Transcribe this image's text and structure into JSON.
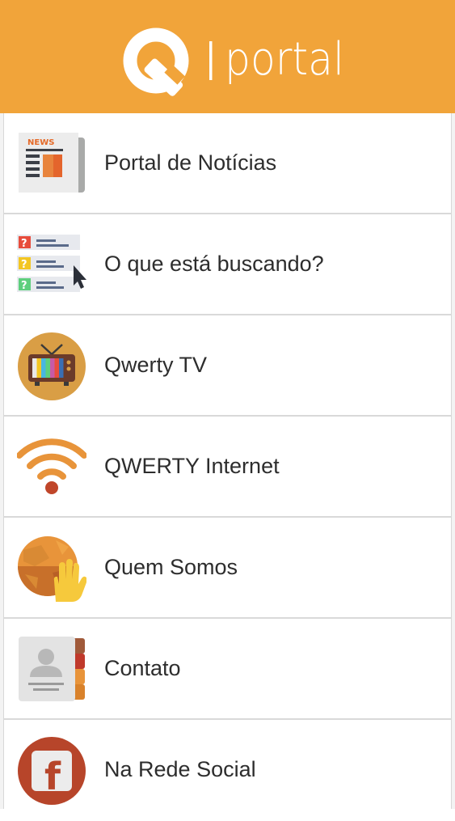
{
  "header": {
    "brand_text": "portal",
    "background_color": "#f1a43a"
  },
  "menu": {
    "items": [
      {
        "label": "Portal de Notícias",
        "icon": "newspaper-icon",
        "badge": "NEWS"
      },
      {
        "label": "O que está buscando?",
        "icon": "question-list-icon",
        "marks": [
          "?",
          "?",
          "?"
        ]
      },
      {
        "label": "Qwerty TV",
        "icon": "tv-icon"
      },
      {
        "label": "QWERTY Internet",
        "icon": "wifi-icon"
      },
      {
        "label": "Quem Somos",
        "icon": "globe-hand-icon"
      },
      {
        "label": "Contato",
        "icon": "address-book-icon"
      },
      {
        "label": "Na Rede Social",
        "icon": "facebook-icon",
        "glyph": "f"
      }
    ]
  }
}
